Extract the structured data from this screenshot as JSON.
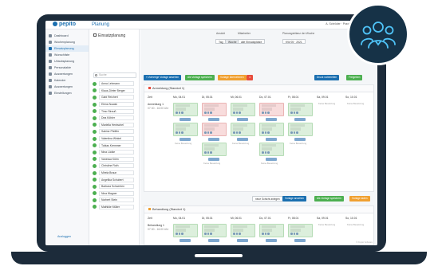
{
  "app": {
    "logo": "pepito",
    "title": "Planung",
    "user_info": "A. Schröder · Praxis für Mustermann"
  },
  "sidebar": {
    "items": [
      {
        "label": "Dashboard",
        "active": false
      },
      {
        "label": "Wochenplanung",
        "active": false
      },
      {
        "label": "Einsatzplanung",
        "active": true
      },
      {
        "label": "Wunschliste",
        "active": false
      },
      {
        "label": "Urlaubsplanung",
        "active": false
      },
      {
        "label": "Personalakte",
        "active": false
      },
      {
        "label": "Auswertungen",
        "active": false
      },
      {
        "label": "Kalender",
        "active": false
      },
      {
        "label": "Auswertungen",
        "active": false
      },
      {
        "label": "Einstellungen",
        "active": false
      }
    ],
    "logout": "Ausloggen"
  },
  "page": {
    "title": "Einsatzplanung"
  },
  "search": {
    "placeholder": "Suche"
  },
  "staff": [
    "Anna Lehmann",
    "Klaus-Dieter Berger",
    "Gabi Reichert",
    "Elena Nowak",
    "Timo Strauß",
    "Dea Köhler",
    "Mariella Hentschel",
    "Sabine Pfeiffer",
    "Valentina Winkel",
    "Tobias Kremmer",
    "Nina Lüdke",
    "Vanessa Kühn",
    "Christine Roth",
    "Mirela Braun",
    "Angelika Schubert",
    "Barbara Schwerten",
    "Nina Wagner",
    "Norbert Stein",
    "Mathilde Müller"
  ],
  "view": {
    "label_view": "Ansicht",
    "label_filter": "Mitarbeiter",
    "label_week": "Planungsbilanz der Woche",
    "btn_day": "Tag",
    "btn_week": "Woche",
    "select_area": "alle Einsatzplätze",
    "select_week": "KW 05 · 2021"
  },
  "toolbar": {
    "prev_week": "« Vorherige Vorlage ansehen",
    "copy": "Als Vorlage speichern",
    "tmpl": "Vorlage übernehmen",
    "print": "Druck vorbereiten",
    "publish": "Freigeben"
  },
  "section1": {
    "title": "Anmeldung (Standort 1)",
    "col_time": "Zeit",
    "days": [
      "Mo, 04.01",
      "Di, 05.01",
      "Mi, 06.01",
      "Do, 07.01",
      "Fr, 08.01",
      "Sa, 09.01",
      "So, 10.01"
    ],
    "row_title": "Anmeldung 1",
    "row_time": "07:30 - 16:00 Uhr",
    "note": "Keine Besetzung"
  },
  "mid": {
    "add_shift": "neue Schicht anlegen",
    "tmpl1": "Vorlage ansehen",
    "tmpl2": "Als Vorlage speichern",
    "tmpl3": "Vorlage laden",
    "next": "Nächste Vorlage ansehen"
  },
  "section2": {
    "title": "Behandlung (Standort 1)",
    "col_time": "Zeit",
    "days": [
      "Mo, 04.01",
      "Di, 05.01",
      "Mi, 06.01",
      "Do, 07.01",
      "Fr, 08.01",
      "Sa, 09.01",
      "So, 10.01"
    ],
    "row_title": "Behandlung 1",
    "row_time": "07:30 - 16:00 Uhr",
    "note": "Keine Besetzung"
  },
  "footer": "© Pepito Software",
  "colors": {
    "primary": "#1a6fb0",
    "green": "#4caf50",
    "orange": "#f0a030",
    "red": "#e74c3c",
    "frame": "#1c2b3a"
  }
}
